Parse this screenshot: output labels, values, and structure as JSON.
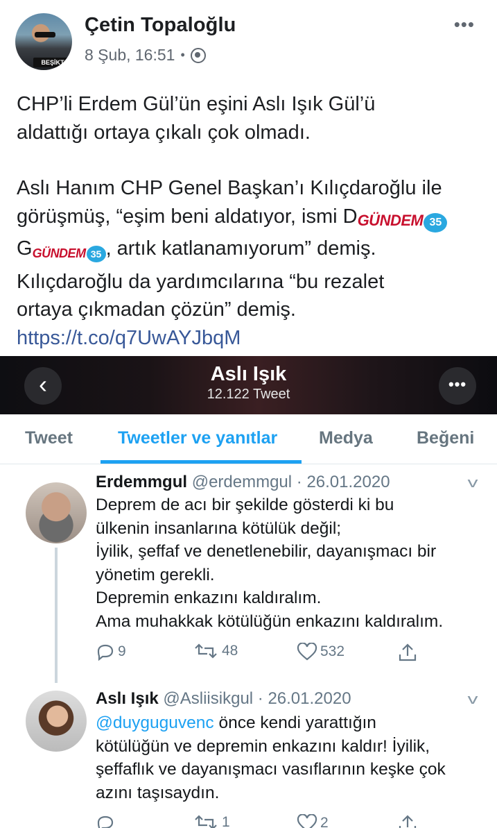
{
  "post": {
    "author": "Çetin Topaloğlu",
    "date": "8 Şub, 16:51",
    "dot": "•",
    "avatar_badge": "BEŞİKT",
    "para1_line1": "CHP’li Erdem Gül’ün eşini Aslı Işık Gül’ü",
    "para1_line2": "aldattığı ortaya çıkalı çok olmadı.",
    "para2_line1": "Aslı Hanım CHP Genel Başkan’ı Kılıçdaroğlu ile",
    "para2_line2_pre": "görüşmüş, “eşim beni aldatıyor, ismi D",
    "para2_line3_pre": "G",
    "para2_line3_post": ", artık katlanamıyorum” demiş.",
    "para2_line4": "Kılıçdaroğlu da yardımcılarına “bu rezalet",
    "para2_line5": "ortaya çıkmadan çözün” demiş.",
    "link": "https://t.co/q7UwAYJbqM",
    "watermark_text": "GÜNDEM",
    "watermark_num": "35"
  },
  "twitter": {
    "title": "Aslı Işık",
    "tweet_count": "12.122 Tweet",
    "back_icon": "‹",
    "more_icon": "•••",
    "tabs": [
      "Tweet",
      "Tweetler ve yanıtlar",
      "Medya",
      "Beğeni"
    ],
    "active_tab": 1,
    "accent": "#1da1f2",
    "tweets": [
      {
        "name": "Erdemmgul",
        "handle": "@erdemmgul · 26.01.2020",
        "lines": [
          "Deprem de acı bir şekilde gösterdi ki bu",
          "ülkenin insanlarına kötülük değil;",
          "İyilik, şeffaf ve denetlenebilir, dayanışmacı bir",
          "yönetim gerekli.",
          "Depremin enkazını kaldıralım.",
          "Ama muhakkak kötülüğün enkazını kaldıralım."
        ],
        "replies": "9",
        "retweets": "48",
        "likes": "532"
      },
      {
        "name": "Aslı Işık",
        "handle": "@Asliisikgul · 26.01.2020",
        "mention": "@duyguguvenc",
        "line1_rest": " önce kendi yarattığın",
        "lines": [
          "kötülüğün ve depremin enkazını kaldır! İyilik,",
          "şeffaflık ve dayanışmacı vasıflarının keşke çok",
          "azını taşısaydın."
        ],
        "replies": "",
        "retweets": "1",
        "likes": "2"
      }
    ]
  }
}
